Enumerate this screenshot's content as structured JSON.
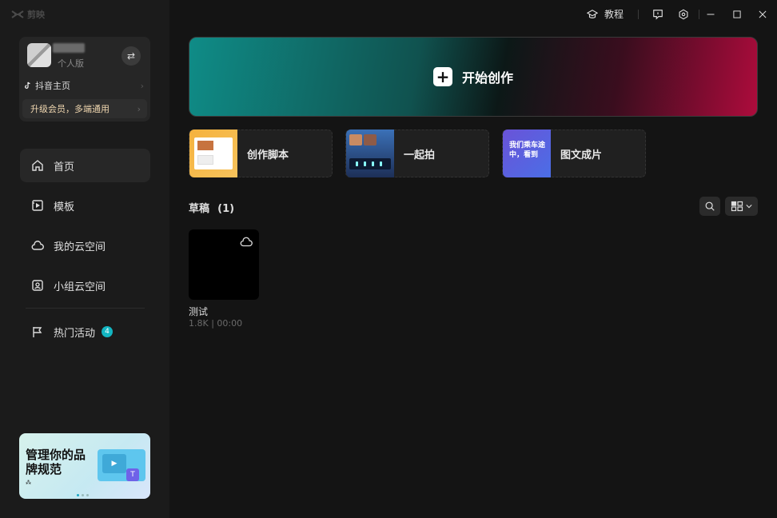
{
  "app": {
    "name": "剪映"
  },
  "user": {
    "edition": "个人版",
    "douyin_link": "抖音主页",
    "vip_text": "升级会员，多端通用"
  },
  "sidebar": {
    "items": [
      {
        "label": "首页",
        "icon": "home-icon"
      },
      {
        "label": "模板",
        "icon": "template-icon"
      },
      {
        "label": "我的云空间",
        "icon": "cloud-icon"
      },
      {
        "label": "小组云空间",
        "icon": "group-cloud-icon"
      },
      {
        "label": "热门活动",
        "icon": "flag-icon",
        "badge": "4"
      }
    ]
  },
  "promo": {
    "title": "管理你的品牌规范"
  },
  "topbar": {
    "tutorial_label": "教程"
  },
  "main": {
    "create_label": "开始创作",
    "quick_actions": [
      {
        "label": "创作脚本"
      },
      {
        "label": "一起拍"
      },
      {
        "label": "图文成片",
        "thumb_text": "我们乘车途中，看到"
      }
    ],
    "drafts": {
      "title": "草稿",
      "count": "(1)"
    },
    "draft_items": [
      {
        "name": "测试",
        "meta": "1.8K | 00:00"
      }
    ]
  },
  "colors": {
    "accent_teal": "#13b5c1",
    "create_gradient_start": "#0f8c87",
    "create_gradient_end": "#ad0c3c"
  }
}
